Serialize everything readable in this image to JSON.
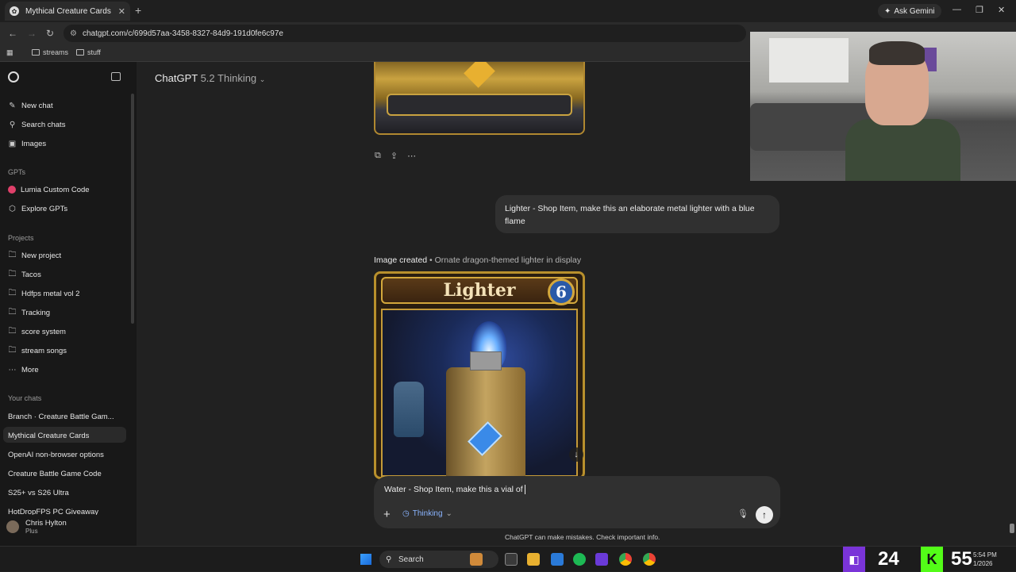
{
  "browser": {
    "tab_title": "Mythical Creature Cards",
    "url": "chatgpt.com/c/699d57aa-3458-8327-84d9-191d0fe6c97e",
    "ask_gemini": "Ask Gemini",
    "bookmarks": [
      "streams",
      "stuff"
    ]
  },
  "sidebar": {
    "top_items": [
      {
        "label": "New chat",
        "icon": "pencil-icon"
      },
      {
        "label": "Search chats",
        "icon": "search-icon"
      },
      {
        "label": "Images",
        "icon": "image-icon"
      }
    ],
    "gpts_heading": "GPTs",
    "gpts": [
      {
        "label": "Lumia Custom Code",
        "icon": "gpt-avatar-icon"
      },
      {
        "label": "Explore GPTs",
        "icon": "cube-icon"
      }
    ],
    "projects_heading": "Projects",
    "projects": [
      {
        "label": "New project",
        "icon": "new-folder-icon"
      },
      {
        "label": "Tacos",
        "icon": "folder-icon"
      },
      {
        "label": "Hdfps metal vol 2",
        "icon": "folder-icon"
      },
      {
        "label": "Tracking",
        "icon": "folder-icon"
      },
      {
        "label": "score system",
        "icon": "folder-icon"
      },
      {
        "label": "stream songs",
        "icon": "folder-icon"
      },
      {
        "label": "More",
        "icon": "dots-icon"
      }
    ],
    "chats_heading": "Your chats",
    "chats": [
      "Branch · Creature Battle Gam...",
      "Mythical Creature Cards",
      "OpenAI non-browser options",
      "Creature Battle Game Code",
      "S25+ vs S26 Ultra",
      "HotDropFPS PC Giveaway"
    ],
    "active_chat_index": 1,
    "user": {
      "name": "Chris Hylton",
      "plan": "Plus"
    }
  },
  "main": {
    "model_name": "ChatGPT",
    "model_version": "5.2 Thinking",
    "user_message": "Lighter - Shop Item, make this an elaborate metal lighter with a blue flame",
    "image_created_label": "Image created",
    "image_created_desc": "• Ornate dragon-themed lighter in display",
    "card_title": "Lighter",
    "card_cost": "6",
    "composer_text": "Water - Shop Item, make this a vial of",
    "thinking_label": "Thinking",
    "disclaimer": "ChatGPT can make mistakes. Check important info."
  },
  "taskbar": {
    "search_label": "Search",
    "twitch_count": "24",
    "kick_count": "55",
    "time": "5:54 PM",
    "date": "1/2026"
  },
  "colors": {
    "accent_blue": "#8ab4ff",
    "sidebar_bg": "#181818",
    "main_bg": "#212121",
    "bubble_bg": "#303030"
  }
}
